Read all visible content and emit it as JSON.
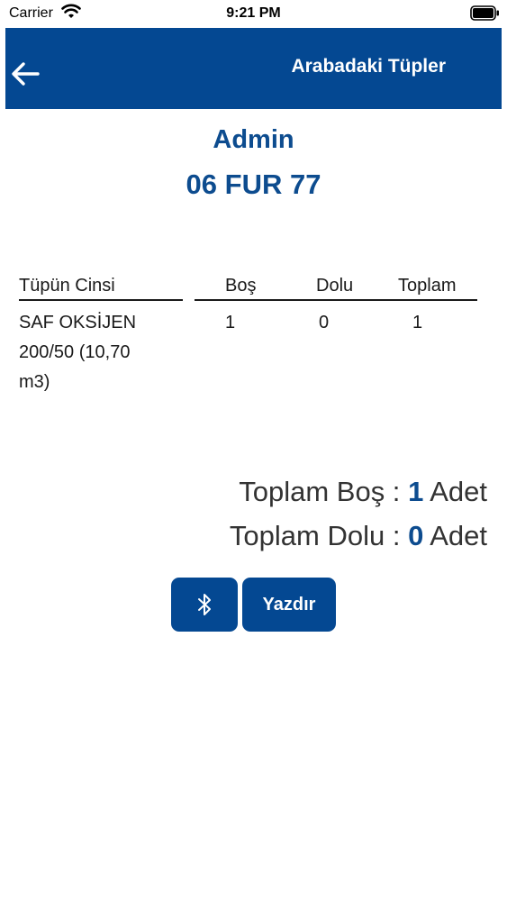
{
  "status_bar": {
    "carrier": "Carrier",
    "time": "9:21 PM"
  },
  "header": {
    "title": "Arabadaki Tüpler",
    "back_icon": "arrow-left-icon",
    "background": "#044892"
  },
  "user": {
    "name": "Admin",
    "plate": "06 FUR 77"
  },
  "table": {
    "columns": [
      "Tüpün Cinsi",
      "Boş",
      "Dolu",
      "Toplam"
    ],
    "rows": [
      {
        "type_lines": [
          "SAF OKSİJEN",
          "200/50 (10,70",
          "m3)"
        ],
        "bos": "1",
        "dolu": "0",
        "toplam": "1"
      }
    ]
  },
  "summary": {
    "bos_label": "Toplam Boş :",
    "bos_value": "1",
    "dolu_label": "Toplam Dolu :",
    "dolu_value": "0",
    "unit": "Adet"
  },
  "buttons": {
    "bluetooth_icon": "bluetooth-icon",
    "print_label": "Yazdır"
  },
  "colors": {
    "accent": "#0d4c8f",
    "button": "#044892"
  }
}
